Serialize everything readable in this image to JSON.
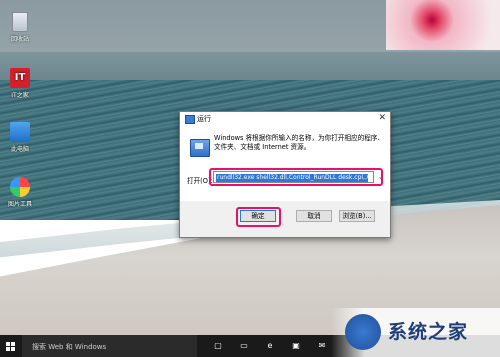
{
  "desktop": {
    "icons": [
      {
        "label": "回收站",
        "icon": "recycle-bin-icon"
      },
      {
        "label": "IT之家",
        "icon": "ithome-icon"
      },
      {
        "label": "此电脑",
        "icon": "this-pc-icon"
      },
      {
        "label": "图片工具",
        "icon": "photo-tool-icon"
      }
    ]
  },
  "run_dialog": {
    "title": "运行",
    "close": "✕",
    "description": "Windows 将根据你所输入的名称，为你打开相应的程序、文件夹、文档或 Internet 资源。",
    "open_label": "打开(O):",
    "command": "rundll32.exe shell32.dll,Control_RunDLL desk.cpl,,0",
    "buttons": {
      "ok": "确定",
      "cancel": "取消",
      "browse": "浏览(B)..."
    }
  },
  "taskbar": {
    "search_placeholder": "搜索 Web 和 Windows"
  },
  "watermark": {
    "text": "系统之家"
  },
  "colors": {
    "highlight": "#e8116a",
    "selection": "#2f78d6",
    "taskbar": "#1a1a1a"
  }
}
